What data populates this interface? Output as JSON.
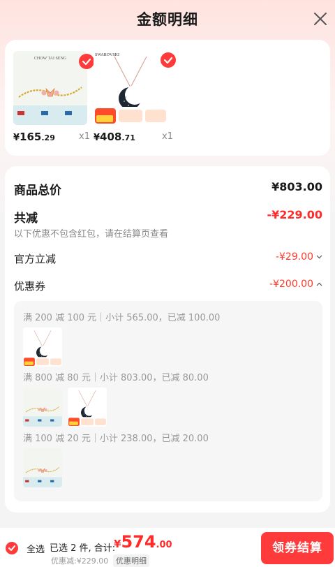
{
  "header": {
    "title": "金额明细"
  },
  "products": [
    {
      "brand": "CHOW TAI SENG",
      "price_yen": "¥",
      "price_int": "165",
      "price_dec": ".29",
      "qty": "x1"
    },
    {
      "brand": "SWAROVSKI",
      "price_yen": "¥",
      "price_int": "408",
      "price_dec": ".71",
      "qty": "x1"
    }
  ],
  "summary": {
    "total_label": "商品总价",
    "total_value": "¥803.00",
    "discount_label": "共减",
    "discount_value": "-¥229.00",
    "discount_note": "以下优惠不包含红包，请在结算页查看",
    "official_label": "官方立减",
    "official_value": "-¥29.00",
    "coupon_label": "优惠券",
    "coupon_value": "-¥200.00"
  },
  "coupons": [
    {
      "text": "满 200 减 100 元｜小计 565.00，已减 100.00"
    },
    {
      "text": "满 800 减 80 元｜小计 803.00，已减 80.00"
    },
    {
      "text": "满 100 减 20 元｜小计 238.00，已减 20.00"
    }
  ],
  "bottom": {
    "select_all": "全选",
    "selected_text": "已选 2 件, 合计:",
    "total_yen": "¥",
    "total_int": "574",
    "total_dec": ".00",
    "discount_text": "优惠减:¥229.00",
    "detail_link": "优惠明细",
    "checkout": "领券结算"
  },
  "colors": {
    "accent": "#ff2b2b",
    "button": "#ff3a3a"
  }
}
